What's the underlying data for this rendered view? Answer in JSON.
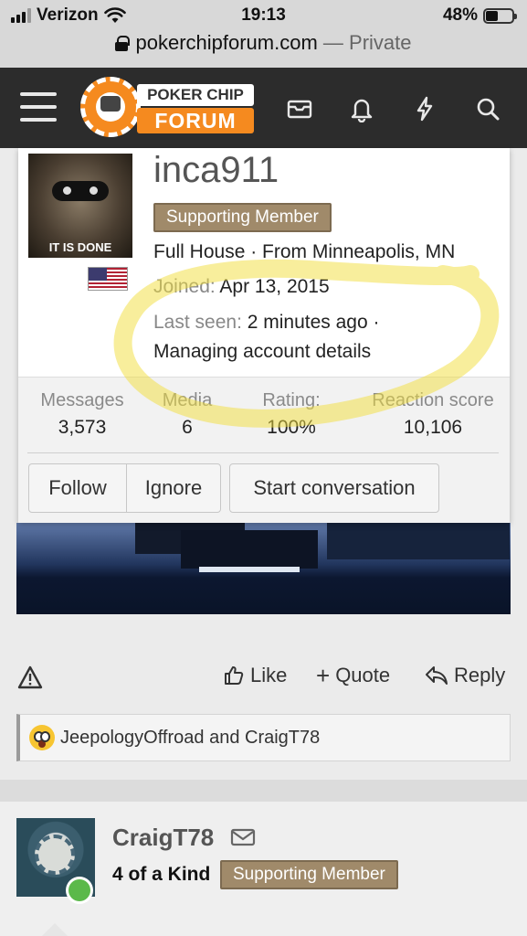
{
  "status_bar": {
    "carrier": "Verizon",
    "time": "19:13",
    "battery": "48%",
    "battery_level": 0.48
  },
  "url_bar": {
    "domain": "pokerchipforum.com",
    "separator": " — ",
    "mode": "Private"
  },
  "site": {
    "logo_line1": "POKER CHIP",
    "logo_line2": "FORUM",
    "accent_color": "#f58a1f"
  },
  "profile": {
    "username": "inca911",
    "avatar_caption": "IT IS DONE",
    "badge": "Supporting Member",
    "rank_location": "Full House · From Minneapolis, MN",
    "joined_label": "Joined:",
    "joined_value": "Apr 13, 2015",
    "last_seen_label": "Last seen:",
    "last_seen_value": "2 minutes ago ·",
    "activity": "Managing account details",
    "stats": [
      {
        "label": "Messages",
        "value": "3,573"
      },
      {
        "label": "Media",
        "value": "6"
      },
      {
        "label": "Rating:",
        "value": "100%"
      },
      {
        "label": "Reaction score",
        "value": "10,106"
      }
    ],
    "buttons": {
      "follow": "Follow",
      "ignore": "Ignore",
      "start_conversation": "Start conversation"
    }
  },
  "post_actions": {
    "like": "Like",
    "quote": "Quote",
    "reply": "Reply"
  },
  "reactions": {
    "text": "JeepologyOffroad and CraigT78"
  },
  "next_post": {
    "username": "CraigT78",
    "rank": "4 of a Kind",
    "badge": "Supporting Member"
  }
}
